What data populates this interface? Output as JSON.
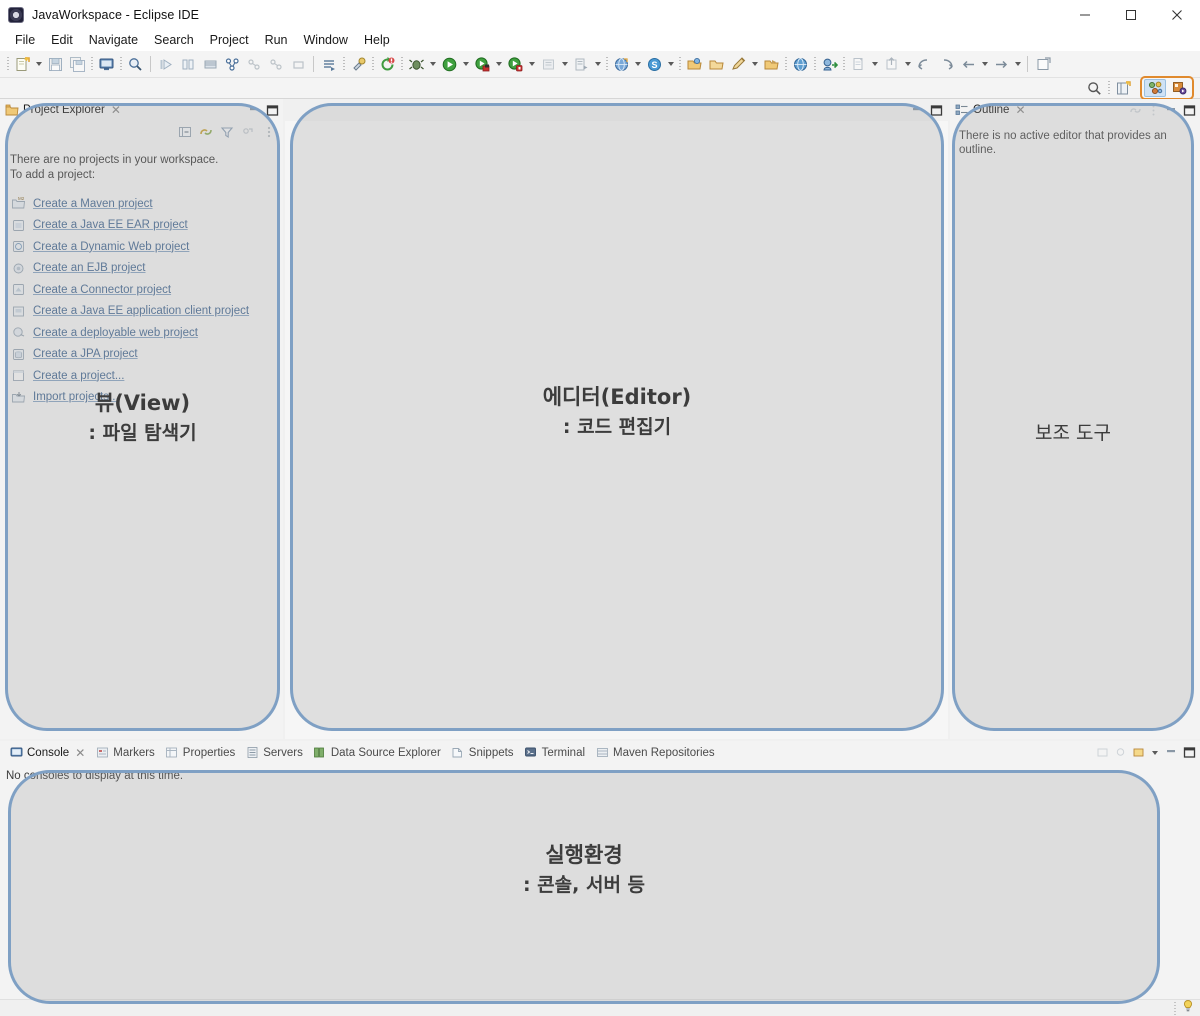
{
  "window": {
    "title": "JavaWorkspace - Eclipse IDE",
    "app_icon": "eclipse-icon",
    "minimize": "─",
    "maximize": "□",
    "close": "✕"
  },
  "menubar": {
    "items": [
      {
        "label": "File"
      },
      {
        "label": "Edit"
      },
      {
        "label": "Navigate"
      },
      {
        "label": "Search"
      },
      {
        "label": "Project"
      },
      {
        "label": "Run"
      },
      {
        "label": "Window"
      },
      {
        "label": "Help"
      }
    ]
  },
  "toolbar": {
    "groups": [
      {
        "icons": [
          "new-wizard-icon",
          "new-wizard-dropdown",
          "save-icon",
          "save-all-icon"
        ]
      },
      {
        "icons": [
          "open-console-icon"
        ]
      },
      {
        "icons": [
          "search-declaration-icon"
        ]
      },
      {
        "icons": [
          "skip-breakpoints-icon",
          "step-over-icon",
          "terminate-icon",
          "build-icon",
          "build-all-icon",
          "build-clean-icon",
          "build-project-icon"
        ]
      },
      {
        "icons": [
          "refresh-icon"
        ]
      },
      {
        "icons": [
          "external-tools-icon",
          "debug-icon",
          "run-icon",
          "coverage-icon",
          "profile-icon",
          "run-last-tool-icon",
          "server-run-icon",
          "web-browser-icon",
          "s-icon"
        ]
      },
      {
        "icons": [
          "open-type-icon",
          "open-resource-icon",
          "pencil-icon",
          "open-task-icon",
          "globe-icon",
          "deploy-icon",
          "new-java-class-icon",
          "new-package-icon",
          "back-icon",
          "forward-icon",
          "prev-annotation-icon",
          "next-annotation-icon",
          "new-editor-icon"
        ]
      }
    ],
    "search_icon": "search-icon",
    "open-perspective-icon": "open-perspective-icon",
    "perspectives": [
      {
        "name": "java-ee-perspective-icon",
        "active": true
      },
      {
        "name": "java-perspective-icon",
        "active": false
      }
    ],
    "perspective_highlight_color": "#e08a2e"
  },
  "project_explorer": {
    "tab_label": "Project Explorer",
    "tab_icon": "project-explorer-icon",
    "close_glyph": "✕",
    "view_toolbar": [
      "collapse-all-icon",
      "link-with-editor-icon",
      "filter-icon",
      "focus-icon",
      "view-menu-icon"
    ],
    "minimize_glyph": "minimize-icon",
    "maximize_glyph": "maximize-icon",
    "intro_line1": "There are no projects in your workspace.",
    "intro_line2": "To add a project:",
    "links": [
      {
        "label": "Create a Maven project",
        "icon": "maven-project-icon"
      },
      {
        "label": "Create a Java EE EAR project",
        "icon": "ear-project-icon"
      },
      {
        "label": "Create a Dynamic Web project",
        "icon": "web-project-icon"
      },
      {
        "label": "Create an EJB project",
        "icon": "ejb-project-icon"
      },
      {
        "label": "Create a Connector project",
        "icon": "connector-project-icon"
      },
      {
        "label": "Create a Java EE application client project",
        "icon": "app-client-project-icon"
      },
      {
        "label": "Create a deployable web project",
        "icon": "deployable-web-icon"
      },
      {
        "label": "Create a JPA project",
        "icon": "jpa-project-icon"
      },
      {
        "label": "Create a project...",
        "icon": "generic-project-icon"
      },
      {
        "label": "Import projects...",
        "icon": "import-projects-icon"
      }
    ]
  },
  "editor": {
    "minimize_glyph": "minimize-icon",
    "maximize_glyph": "maximize-icon"
  },
  "outline": {
    "tab_label": "Outline",
    "tab_icon": "outline-icon",
    "close_glyph": "✕",
    "view_toolbar": [
      "link-icon",
      "view-menu-icon"
    ],
    "minimize_glyph": "minimize-icon",
    "maximize_glyph": "maximize-icon",
    "message": "There is no active editor that provides an outline."
  },
  "console": {
    "tabs": [
      {
        "label": "Console",
        "icon": "console-icon",
        "active": true,
        "closable": true
      },
      {
        "label": "Markers",
        "icon": "markers-icon",
        "active": false,
        "closable": false
      },
      {
        "label": "Properties",
        "icon": "properties-icon",
        "active": false,
        "closable": false
      },
      {
        "label": "Servers",
        "icon": "servers-icon",
        "active": false,
        "closable": false
      },
      {
        "label": "Data Source Explorer",
        "icon": "data-source-explorer-icon",
        "active": false,
        "closable": false
      },
      {
        "label": "Snippets",
        "icon": "snippets-icon",
        "active": false,
        "closable": false
      },
      {
        "label": "Terminal",
        "icon": "terminal-icon",
        "active": false,
        "closable": false
      },
      {
        "label": "Maven Repositories",
        "icon": "maven-repositories-icon",
        "active": false,
        "closable": false
      }
    ],
    "view_toolbar": [
      "open-console-icon",
      "pin-console-icon",
      "display-console-dropdown-icon",
      "new-console-icon"
    ],
    "minimize_glyph": "minimize-icon",
    "maximize_glyph": "maximize-icon",
    "message": "No consoles to display at this time."
  },
  "statusbar": {
    "tip_icon": "lightbulb-icon"
  },
  "annotations": {
    "stroke_color": "#7fa0c4",
    "view": {
      "line1": "뷰(View)",
      "line2": ": 파일 탐색기"
    },
    "editor": {
      "line1": "에디터(Editor)",
      "line2": ": 코드 편집기"
    },
    "aux": {
      "line1": "보조 도구",
      "line2": ""
    },
    "console": {
      "line1": "실행환경",
      "line2": ": 콘솔, 서버 등"
    }
  }
}
